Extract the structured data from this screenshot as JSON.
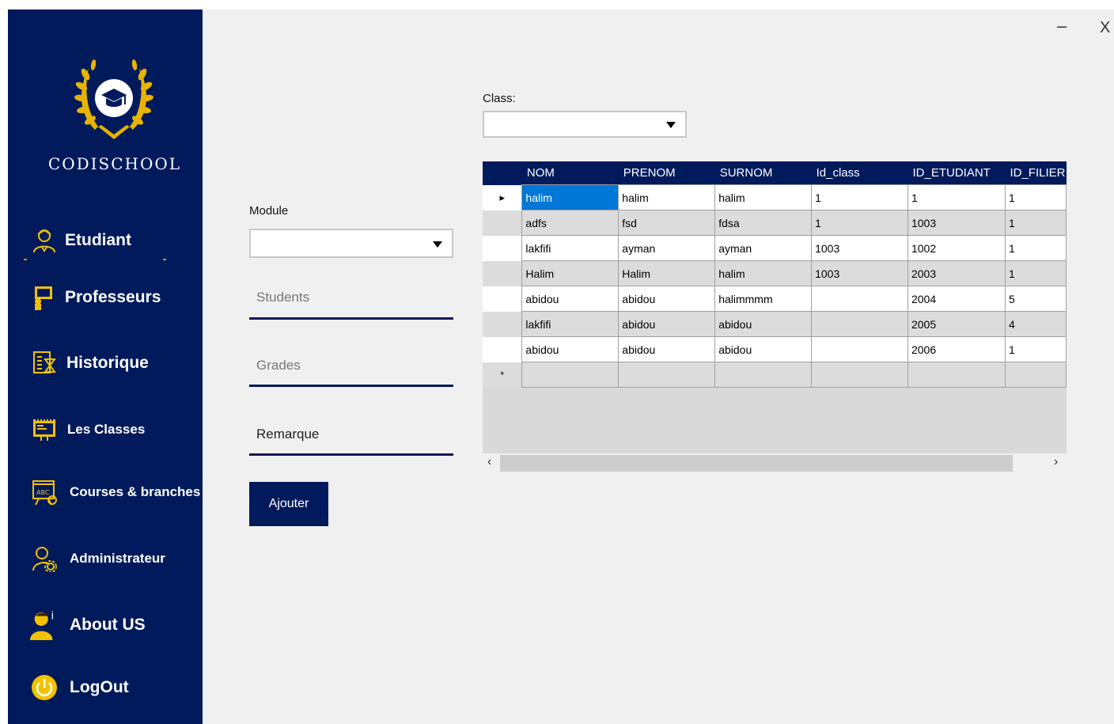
{
  "window": {
    "minimize_label": "–",
    "close_label": "X"
  },
  "sidebar": {
    "brand": "CODISCHOOL",
    "items": [
      {
        "label": "Etudiant",
        "icon": "student-icon"
      },
      {
        "label": "Professeurs",
        "icon": "teacher-icon"
      },
      {
        "label": "Historique",
        "icon": "history-icon"
      },
      {
        "label": "Les Classes",
        "icon": "classes-icon"
      },
      {
        "label": "Courses & branches",
        "icon": "courses-icon"
      },
      {
        "label": "Administrateur",
        "icon": "admin-icon"
      },
      {
        "label": "About US",
        "icon": "about-icon"
      },
      {
        "label": "LogOut",
        "icon": "power-icon"
      }
    ]
  },
  "form": {
    "class_label": "Class:",
    "class_value": "",
    "module_label": "Module",
    "module_value": "",
    "students_placeholder": "Students",
    "grades_placeholder": "Grades",
    "remarque_label": "Remarque",
    "add_button": "Ajouter"
  },
  "grid": {
    "columns": [
      "NOM",
      "PRENOM",
      "SURNOM",
      "Id_class",
      "ID_ETUDIANT",
      "ID_FILIER"
    ],
    "rows": [
      [
        "halim",
        "halim",
        "halim",
        "1",
        "1",
        "1"
      ],
      [
        "adfs",
        "fsd",
        "fdsa",
        "1",
        "1003",
        "1"
      ],
      [
        "lakfifi",
        "ayman",
        "ayman",
        "1003",
        "1002",
        "1"
      ],
      [
        "Halim",
        "Halim",
        "halim",
        "1003",
        "2003",
        "1"
      ],
      [
        "abidou",
        "abidou",
        "halimmmm",
        "",
        "2004",
        "5"
      ],
      [
        "lakfifi",
        "abidou",
        "abidou",
        "",
        "2005",
        "4"
      ],
      [
        "abidou",
        "abidou",
        "abidou",
        "",
        "2006",
        "1"
      ]
    ],
    "new_row_marker": "*",
    "current_row_marker": "▸"
  },
  "colors": {
    "navy": "#001a5c",
    "gold": "#f2c200",
    "selection": "#0078d7"
  }
}
